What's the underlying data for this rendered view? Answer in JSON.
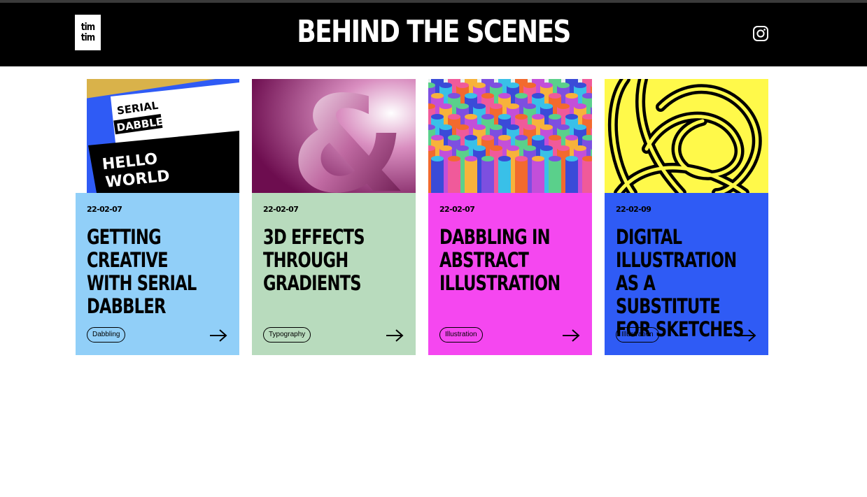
{
  "header": {
    "logo_top": "tim",
    "logo_bottom": "tim",
    "title": "BEHIND THE SCENES",
    "instagram_icon": "instagram-icon"
  },
  "cards": [
    {
      "date": "22-02-07",
      "title": "GETTING CREATIVE WITH SERIAL DABBLER",
      "tag": "Dabbling",
      "bg": "#91cff8",
      "image_text_1": "SERIAL",
      "image_text_2": "DABBLER",
      "image_text_3": "HELLO",
      "image_text_4": "WORLD"
    },
    {
      "date": "22-02-07",
      "title": "3D EFFECTS THROUGH GRADIENTS",
      "tag": "Typography",
      "bg": "#b8dbbd",
      "image_glyph": "&"
    },
    {
      "date": "22-02-07",
      "title": "DABBLING IN ABSTRACT ILLUSTRATION",
      "tag": "Illustration",
      "bg": "#f547f0"
    },
    {
      "date": "22-02-09",
      "title": "DIGITAL ILLUSTRATION AS A SUBSTITUTE FOR SKETCHES",
      "tag": "Illustration",
      "bg": "#2f5bf5"
    }
  ]
}
